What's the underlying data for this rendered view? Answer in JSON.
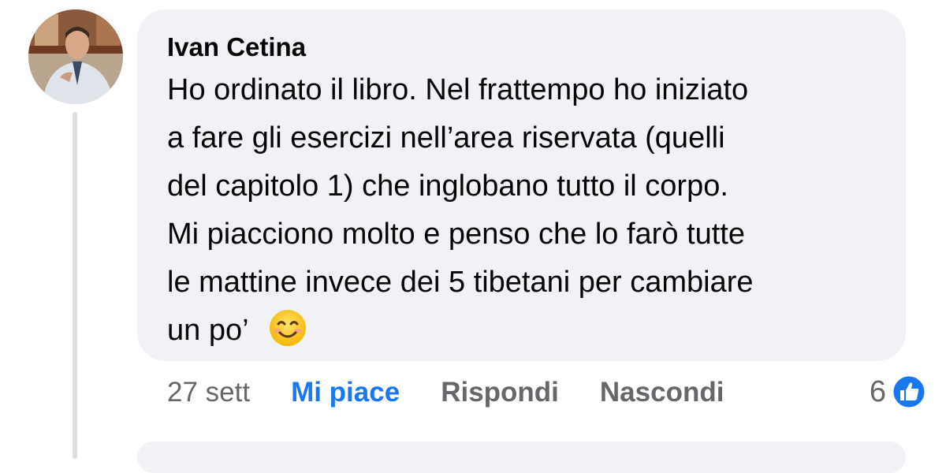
{
  "comment": {
    "author": "Ivan Cetina",
    "lines": [
      "Ho ordinato il libro. Nel frattempo ho iniziato",
      "a fare gli esercizi nell’area riservata (quelli",
      "del capitolo 1) che inglobano tutto il corpo.",
      "Mi piacciono molto e penso che lo farò tutte",
      "le mattine invece dei 5 tibetani per cambiare",
      "un po’"
    ],
    "emoji": "smiling-face-emoji"
  },
  "actions": {
    "timestamp": "27 sett",
    "like_label": "Mi piace",
    "reply_label": "Rispondi",
    "hide_label": "Nascondi"
  },
  "reactions": {
    "count": "6",
    "icon": "thumbs-up-icon",
    "color": "#1877f2"
  },
  "colors": {
    "bubble": "#f0f2f5",
    "secondary_text": "#65676b",
    "accent": "#1877f2"
  }
}
